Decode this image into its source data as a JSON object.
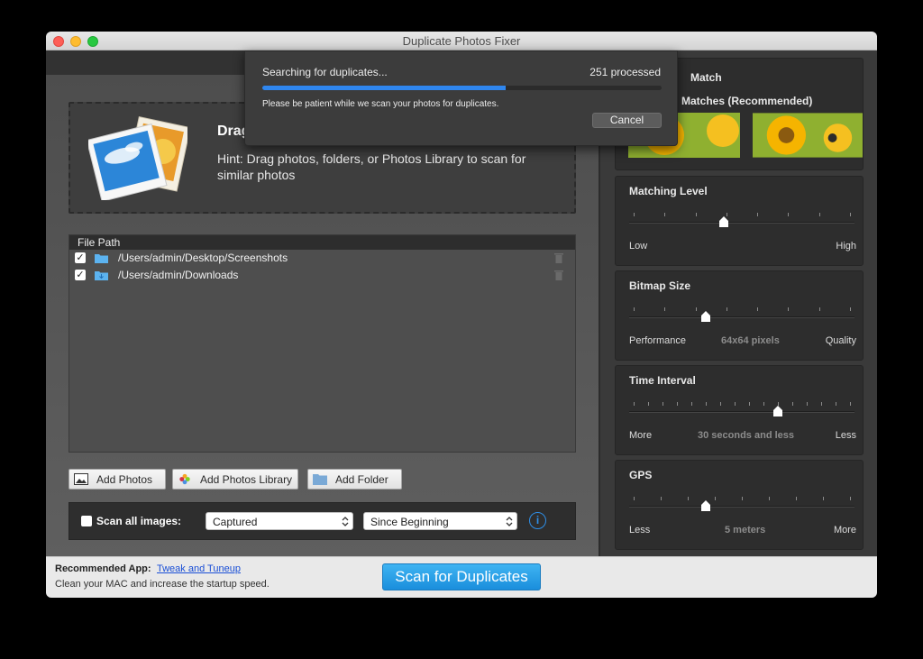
{
  "window": {
    "title": "Duplicate Photos Fixer"
  },
  "dropzone": {
    "title": "Drag",
    "hint": "Hint: Drag photos, folders, or Photos Library to scan for similar photos"
  },
  "filelist": {
    "header": "File Path",
    "rows": [
      {
        "path": "/Users/admin/Desktop/Screenshots",
        "checked": true,
        "folder_icon": "folder-icon"
      },
      {
        "path": "/Users/admin/Downloads",
        "checked": true,
        "folder_icon": "downloads-folder-icon"
      }
    ]
  },
  "buttons": {
    "add_photos": "Add Photos",
    "add_library": "Add Photos Library",
    "add_folder": "Add Folder"
  },
  "scan_options": {
    "scan_all_label": "Scan all images:",
    "scan_all_checked": false,
    "date_type": "Captured",
    "date_range": "Since Beginning"
  },
  "bottom": {
    "recommended_label": "Recommended App:",
    "recommended_link": "Tweak and Tuneup",
    "recommended_desc": "Clean your MAC and increase the startup speed.",
    "scan_button": "Scan for Duplicates"
  },
  "right": {
    "match_title": "Match",
    "match_option": "Matches (Recommended)",
    "matching_level": {
      "title": "Matching Level",
      "left": "Low",
      "right": "High",
      "value": 0.42
    },
    "bitmap_size": {
      "title": "Bitmap Size",
      "left": "Performance",
      "mid": "64x64 pixels",
      "right": "Quality",
      "value": 0.34
    },
    "time_interval": {
      "title": "Time Interval",
      "left": "More",
      "mid": "30 seconds and less",
      "right": "Less",
      "value": 0.66
    },
    "gps": {
      "title": "GPS",
      "left": "Less",
      "mid": "5 meters",
      "right": "More",
      "value": 0.34
    }
  },
  "progress": {
    "title": "Searching for duplicates...",
    "count": "251 processed",
    "fraction": 0.61,
    "message": "Please be patient while we scan your photos for duplicates.",
    "cancel": "Cancel"
  },
  "colors": {
    "accent": "#2f86ee",
    "scan_button": "#1a8edc"
  }
}
